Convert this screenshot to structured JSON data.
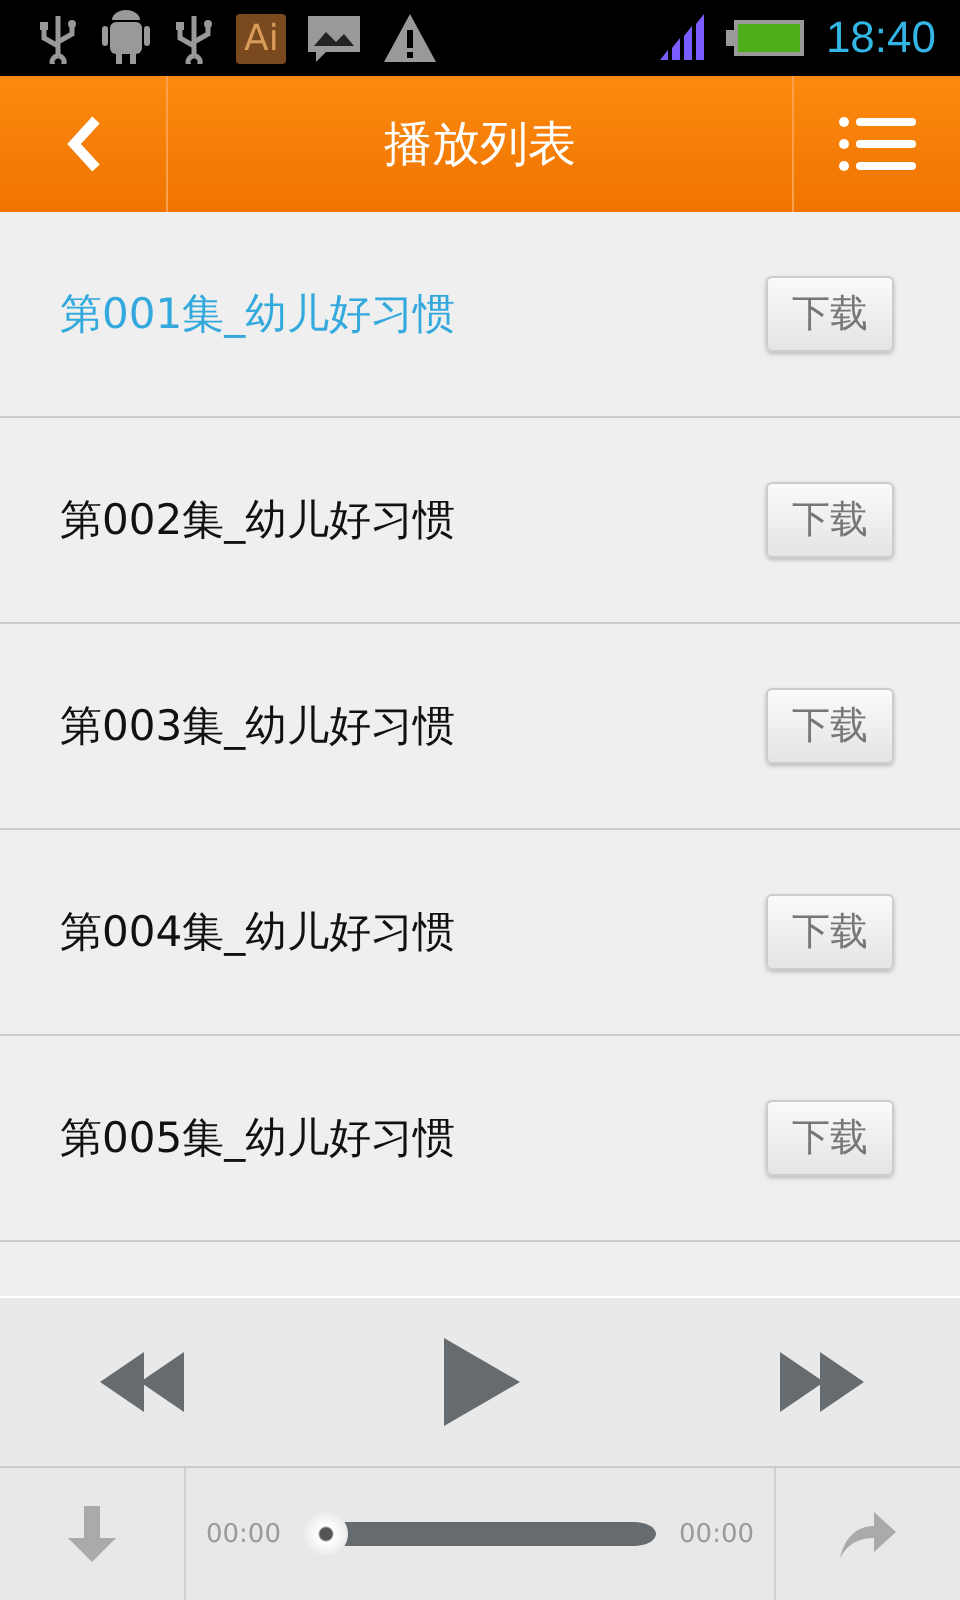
{
  "status_bar": {
    "app_badge": "Ai",
    "time": "18:40"
  },
  "header": {
    "title": "播放列表"
  },
  "playlist": [
    {
      "title": "第001集_幼儿好习惯",
      "selected": true,
      "button": "下载"
    },
    {
      "title": "第002集_幼儿好习惯",
      "selected": false,
      "button": "下载"
    },
    {
      "title": "第003集_幼儿好习惯",
      "selected": false,
      "button": "下载"
    },
    {
      "title": "第004集_幼儿好习惯",
      "selected": false,
      "button": "下载"
    },
    {
      "title": "第005集_幼儿好习惯",
      "selected": false,
      "button": "下载"
    }
  ],
  "player": {
    "elapsed": "00:00",
    "total": "00:00",
    "level": 0
  }
}
